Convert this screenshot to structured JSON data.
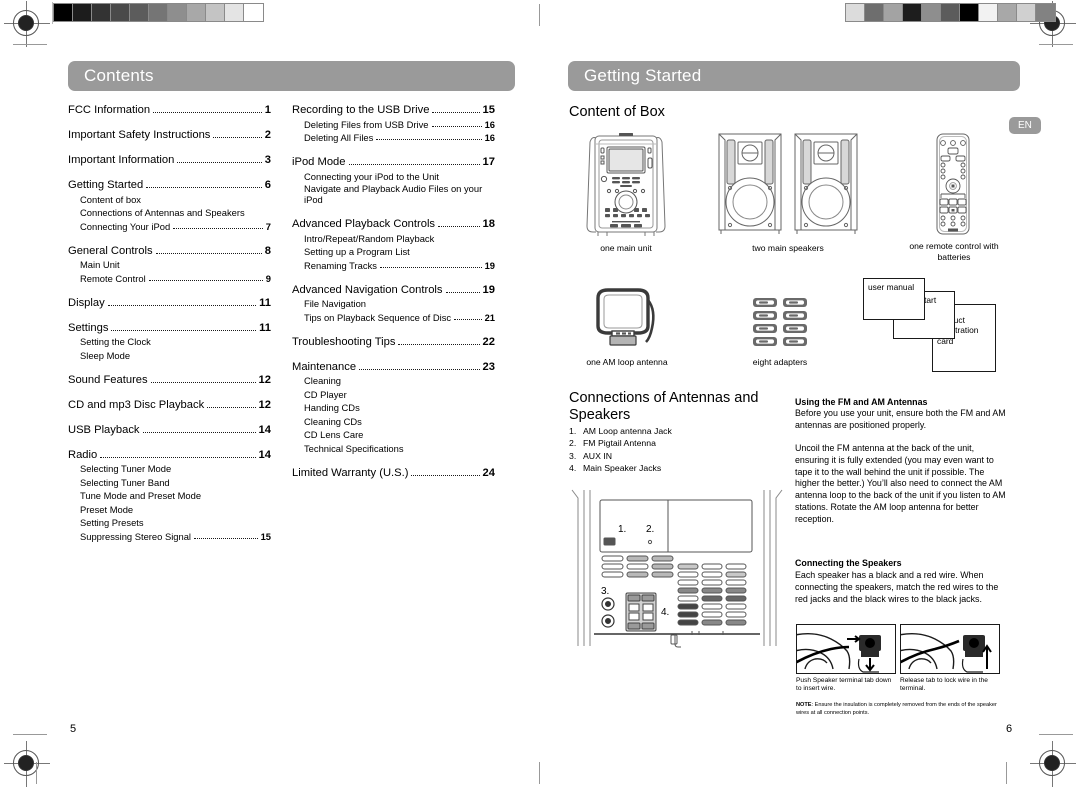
{
  "document": {
    "type": "printed-manual-spread",
    "left_page_number": "5",
    "right_page_number": "6",
    "language_badge": "EN",
    "accent_gray": "#9a9a9a"
  },
  "left_page": {
    "section_title": "Contents",
    "column_1": [
      {
        "title": "FCC Information",
        "page": "1",
        "level": 1,
        "dots": true
      },
      {
        "title": "Important Safety Instructions",
        "page": "2",
        "level": 1,
        "dots": true
      },
      {
        "title": "Important Information",
        "page": "3",
        "level": 1,
        "dots": true
      },
      {
        "title": "Getting Started",
        "page": "6",
        "level": 1,
        "dots": true
      },
      {
        "title": "Content of box",
        "page": "",
        "level": 2,
        "dots": false
      },
      {
        "title": "Connections of Antennas and Speakers",
        "page": "",
        "level": 2,
        "dots": false
      },
      {
        "title": "Connecting Your iPod",
        "page": "7",
        "level": 2,
        "dots": true
      },
      {
        "title": "General Controls",
        "page": "8",
        "level": 1,
        "dots": true
      },
      {
        "title": "Main Unit",
        "page": "",
        "level": 2,
        "dots": false
      },
      {
        "title": "Remote Control",
        "page": "9",
        "level": 2,
        "dots": true
      },
      {
        "title": "Display",
        "page": "11",
        "level": 1,
        "dots": true
      },
      {
        "title": "Settings",
        "page": "11",
        "level": 1,
        "dots": true
      },
      {
        "title": "Setting the Clock",
        "page": "",
        "level": 2,
        "dots": false
      },
      {
        "title": "Sleep Mode",
        "page": "",
        "level": 2,
        "dots": false
      },
      {
        "title": "Sound Features",
        "page": "12",
        "level": 1,
        "dots": true
      },
      {
        "title": "CD and mp3 Disc Playback",
        "page": "12",
        "level": 1,
        "dots": true
      },
      {
        "title": "USB Playback",
        "page": "14",
        "level": 1,
        "dots": true
      },
      {
        "title": "Radio",
        "page": "14",
        "level": 1,
        "dots": true
      },
      {
        "title": "Selecting Tuner Mode",
        "page": "",
        "level": 2,
        "dots": false
      },
      {
        "title": "Selecting Tuner Band",
        "page": "",
        "level": 2,
        "dots": false
      },
      {
        "title": "Tune Mode and Preset Mode",
        "page": "",
        "level": 2,
        "dots": false
      },
      {
        "title": "Preset Mode",
        "page": "",
        "level": 2,
        "dots": false
      },
      {
        "title": "Setting Presets",
        "page": "",
        "level": 2,
        "dots": false
      },
      {
        "title": "Suppressing Stereo Signal",
        "page": "15",
        "level": 2,
        "dots": true
      }
    ],
    "column_2": [
      {
        "title": "Recording to the USB Drive",
        "page": "15",
        "level": 1,
        "dots": true
      },
      {
        "title": "Deleting Files from USB Drive",
        "page": "16",
        "level": 2,
        "dots": true
      },
      {
        "title": "Deleting All Files",
        "page": "16",
        "level": 2,
        "dots": true
      },
      {
        "title": "iPod Mode",
        "page": "17",
        "level": 1,
        "dots": true
      },
      {
        "title": "Connecting your iPod to the Unit",
        "page": "",
        "level": 2,
        "dots": false
      },
      {
        "title": "Navigate and Playback Audio Files on your iPod",
        "page": "",
        "level": 2,
        "dots": false,
        "wrap": true
      },
      {
        "title": "Advanced Playback Controls",
        "page": "18",
        "level": 1,
        "dots": true
      },
      {
        "title": "Intro/Repeat/Random Playback",
        "page": "",
        "level": 2,
        "dots": false
      },
      {
        "title": "Setting up a Program List",
        "page": "",
        "level": 2,
        "dots": false
      },
      {
        "title": "Renaming Tracks",
        "page": "19",
        "level": 2,
        "dots": true
      },
      {
        "title": "Advanced Navigation Controls",
        "page": "19",
        "level": 1,
        "dots": true
      },
      {
        "title": "File Navigation",
        "page": "",
        "level": 2,
        "dots": false
      },
      {
        "title": "Tips on Playback Sequence of Disc",
        "page": "21",
        "level": 2,
        "dots": true
      },
      {
        "title": "Troubleshooting Tips",
        "page": "22",
        "level": 1,
        "dots": true
      },
      {
        "title": "Maintenance",
        "page": "23",
        "level": 1,
        "dots": true
      },
      {
        "title": "Cleaning",
        "page": "",
        "level": 2,
        "dots": false
      },
      {
        "title": "CD Player",
        "page": "",
        "level": 2,
        "dots": false
      },
      {
        "title": "Handing CDs",
        "page": "",
        "level": 2,
        "dots": false
      },
      {
        "title": "Cleaning CDs",
        "page": "",
        "level": 2,
        "dots": false
      },
      {
        "title": "CD Lens Care",
        "page": "",
        "level": 2,
        "dots": false
      },
      {
        "title": "Technical Specifications",
        "page": "",
        "level": 2,
        "dots": false
      },
      {
        "title": "Limited Warranty (U.S.)",
        "page": "24",
        "level": 1,
        "dots": true
      }
    ]
  },
  "right_page": {
    "section_title": "Getting Started",
    "content_of_box": {
      "heading": "Content of Box",
      "items": [
        {
          "caption": "one main unit",
          "icon": "main-unit-illustration"
        },
        {
          "caption": "two main speakers",
          "icon": "speakers-illustration"
        },
        {
          "caption": "one remote control with batteries",
          "icon": "remote-control-illustration"
        },
        {
          "caption": "one AM loop antenna",
          "icon": "am-loop-antenna-illustration"
        },
        {
          "caption": "eight adapters",
          "icon": "adapters-illustration"
        }
      ],
      "documents": [
        {
          "label": "user manual"
        },
        {
          "label": "quick start guide"
        },
        {
          "label": "product registration card"
        }
      ]
    },
    "connections": {
      "heading": "Connections of Antennas and Speakers",
      "items": [
        {
          "num": "1.",
          "label": "AM Loop antenna Jack"
        },
        {
          "num": "2.",
          "label": "FM Pigtail Antenna"
        },
        {
          "num": "3.",
          "label": "AUX IN"
        },
        {
          "num": "4.",
          "label": "Main Speaker Jacks"
        }
      ],
      "diagram_callouts": [
        "1.",
        "2.",
        "3.",
        "4."
      ]
    },
    "antennas": {
      "heading": "Using the FM and AM Antennas",
      "paragraph_1": "Before you use your unit, ensure both the FM and AM antennas are positioned properly.",
      "paragraph_2": "Uncoil the FM antenna at the back of the unit, ensuring it is fully extended (you may even want to tape it to the wall behind the unit if possible. The higher the better.) You’ll also need to connect the AM antenna loop to the back of the unit if you listen to AM stations. Rotate the AM loop antenna for better reception."
    },
    "speakers": {
      "heading": "Connecting the Speakers",
      "paragraph": "Each speaker has a black and a red wire. When connecting the speakers, match the red wires to the red jacks and the black wires to the black jacks.",
      "photo_captions": [
        "Push Speaker terminal tab down to insert wire.",
        "Release tab to lock wire in the terminal."
      ],
      "note_label": "NOTE",
      "note_text": ": Ensure the insulation is completely removed from the ends of the speaker wires at all connection points."
    }
  },
  "printer_marks": {
    "gray_strip_left": [
      "#000000",
      "#1c1c1c",
      "#333333",
      "#4a4a4a",
      "#5c5c5c",
      "#757575",
      "#8e8e8e",
      "#a8a8a8",
      "#c4c4c4",
      "#e4e4e4",
      "#ffffff"
    ],
    "gray_strip_right": [
      "#dcdcdc",
      "#6e6e6e",
      "#a3a3a3",
      "#1d1d1d",
      "#8e8e8e",
      "#5c5c5c",
      "#000000",
      "#f2f2f2",
      "#a8a8a8",
      "#d0d0d0",
      "#828282"
    ]
  }
}
